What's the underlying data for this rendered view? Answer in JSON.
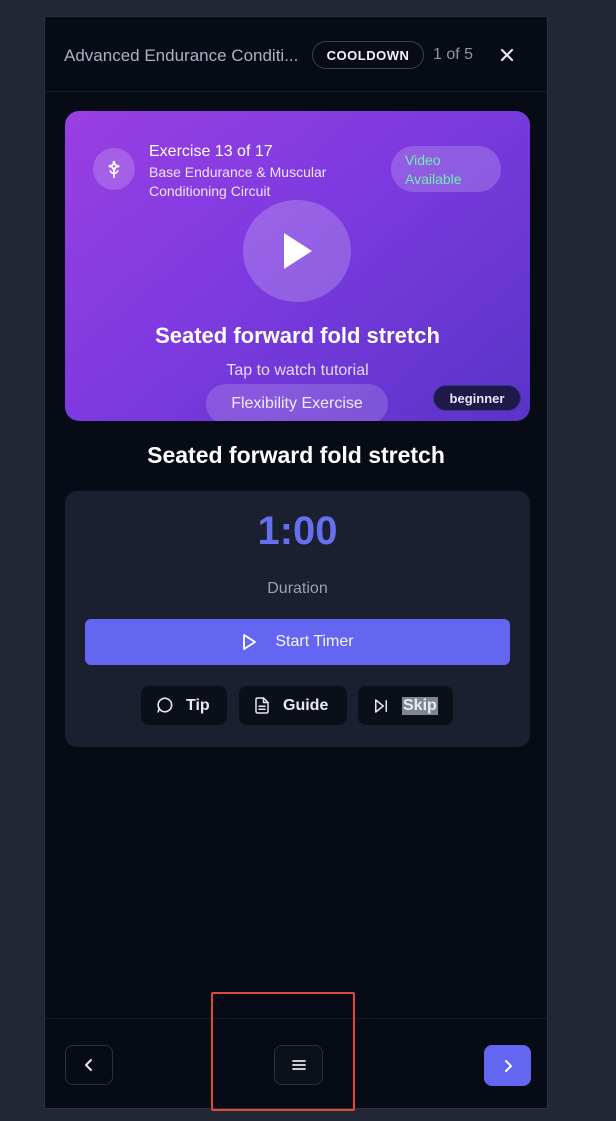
{
  "header": {
    "workout_title": "Advanced Endurance Conditi...",
    "phase_badge": "COOLDOWN",
    "progress": "1 of 5"
  },
  "hero": {
    "exercise_count": "Exercise 13 of 17",
    "circuit_name": "Base Endurance & Muscular Conditioning Circuit",
    "video_label": "Video Available",
    "title": "Seated forward fold stretch",
    "subtitle": "Tap to watch tutorial",
    "category": "Flexibility Exercise",
    "level": "beginner"
  },
  "exercise_name": "Seated forward fold stretch",
  "timer": {
    "time": "1:00",
    "label": "Duration",
    "start_label": "Start Timer"
  },
  "actions": {
    "tip_label": "Tip",
    "guide_label": "Guide",
    "skip_label": "Skip"
  },
  "icons": {
    "close": "close-icon",
    "flower": "flower-icon",
    "play": "play-icon",
    "tip": "message-circle-icon",
    "guide": "file-text-icon",
    "skip": "skip-forward-icon",
    "prev": "chevron-left-icon",
    "menu": "menu-icon",
    "next": "chevron-right-icon"
  },
  "colors": {
    "accent": "#6366f1",
    "video_green": "#6ff0b0",
    "focus_outline": "#e0483a"
  }
}
